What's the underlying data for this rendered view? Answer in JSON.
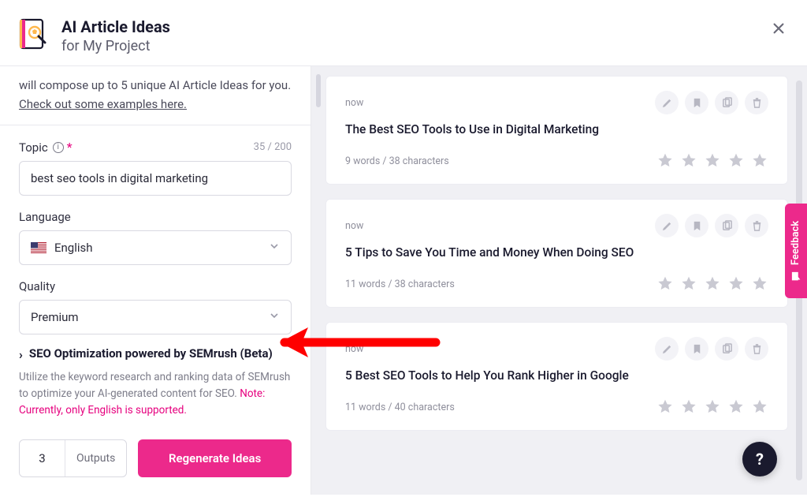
{
  "header": {
    "title": "AI Article Ideas",
    "subtitle": "for My Project"
  },
  "intro": {
    "prefix": "will compose up to 5 unique AI Article Ideas for you. ",
    "link": "Check out some examples here."
  },
  "form": {
    "topic": {
      "label": "Topic",
      "counter": "35 / 200",
      "value": "best seo tools in digital marketing"
    },
    "language": {
      "label": "Language",
      "value": "English"
    },
    "quality": {
      "label": "Quality",
      "value": "Premium"
    }
  },
  "seo": {
    "title": "SEO Optimization powered by SEMrush (Beta)",
    "desc_plain": "Utilize the keyword research and ranking data of SEMrush to optimize your AI-generated content for SEO. ",
    "desc_note": "Note: Currently, only English is supported."
  },
  "outputs": {
    "count": "3",
    "label": "Outputs",
    "button": "Regenerate Ideas"
  },
  "feedback_label": "Feedback",
  "help_label": "?",
  "results": [
    {
      "time": "now",
      "title": "The Best SEO Tools to Use in Digital Marketing",
      "meta": "9 words / 38 characters"
    },
    {
      "time": "now",
      "title": "5 Tips to Save You Time and Money When Doing SEO",
      "meta": "11 words / 38 characters"
    },
    {
      "time": "now",
      "title": "5 Best SEO Tools to Help You Rank Higher in Google",
      "meta": "11 words / 40 characters"
    }
  ]
}
